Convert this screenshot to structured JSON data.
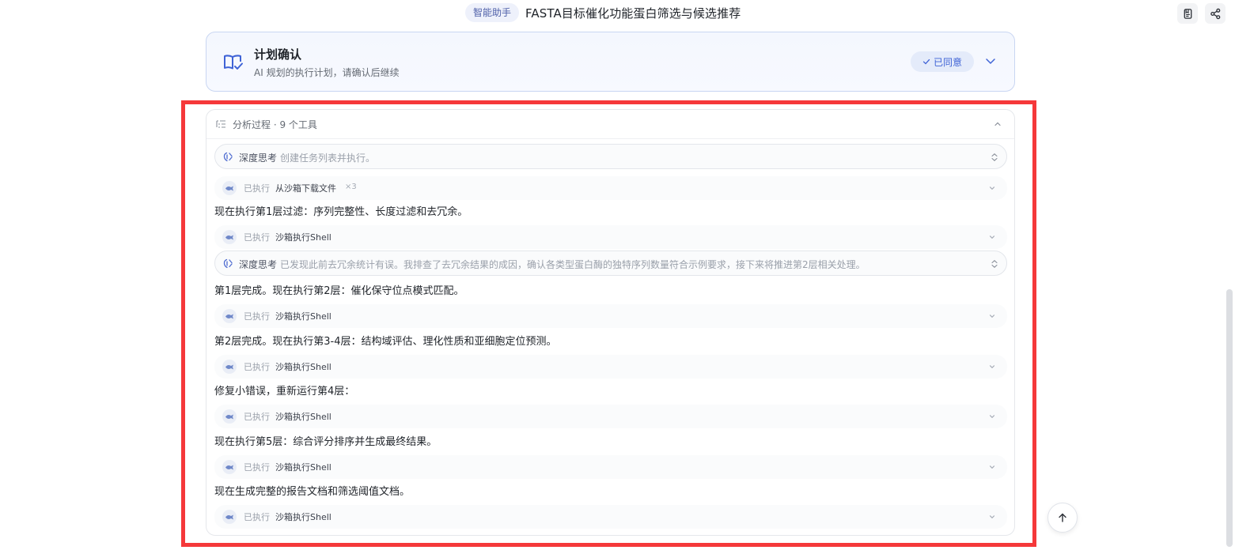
{
  "header": {
    "badge": "智能助手",
    "title": "FASTA目标催化功能蛋白筛选与候选推荐",
    "icons": [
      "copy-document-icon",
      "share-icon"
    ]
  },
  "plan": {
    "title": "计划确认",
    "subtitle": "AI 规划的执行计划，请确认后继续",
    "status": "已同意",
    "icon": "book-check-icon"
  },
  "analysis": {
    "header": "分析过程 · 9 个工具",
    "items": [
      {
        "kind": "think",
        "label": "深度思考",
        "text": "创建任务列表并执行。"
      },
      {
        "kind": "exec",
        "status": "已执行",
        "tool": "从沙箱下载文件",
        "count": "×3"
      },
      {
        "kind": "msg",
        "text": "现在执行第1层过滤：序列完整性、长度过滤和去冗余。"
      },
      {
        "kind": "exec",
        "status": "已执行",
        "tool": "沙箱执行Shell"
      },
      {
        "kind": "think",
        "label": "深度思考",
        "text": "已发现此前去冗余统计有误。我排查了去冗余结果的成因，确认各类型蛋白酶的独特序列数量符合示例要求，接下来将推进第2层相关处理。"
      },
      {
        "kind": "msg",
        "text": "第1层完成。现在执行第2层：催化保守位点模式匹配。"
      },
      {
        "kind": "exec",
        "status": "已执行",
        "tool": "沙箱执行Shell"
      },
      {
        "kind": "msg",
        "text": "第2层完成。现在执行第3-4层：结构域评估、理化性质和亚细胞定位预测。"
      },
      {
        "kind": "exec",
        "status": "已执行",
        "tool": "沙箱执行Shell"
      },
      {
        "kind": "msg",
        "text": "修复小错误，重新运行第4层："
      },
      {
        "kind": "exec",
        "status": "已执行",
        "tool": "沙箱执行Shell"
      },
      {
        "kind": "msg",
        "text": "现在执行第5层：综合评分排序并生成最终结果。"
      },
      {
        "kind": "exec",
        "status": "已执行",
        "tool": "沙箱执行Shell"
      },
      {
        "kind": "msg",
        "text": "现在生成完整的报告文档和筛选阈值文档。"
      },
      {
        "kind": "exec",
        "status": "已执行",
        "tool": "沙箱执行Shell"
      }
    ]
  },
  "colors": {
    "accent": "#3f63d6",
    "highlight": "#f5383a",
    "plan_border": "#c9d6f2"
  }
}
